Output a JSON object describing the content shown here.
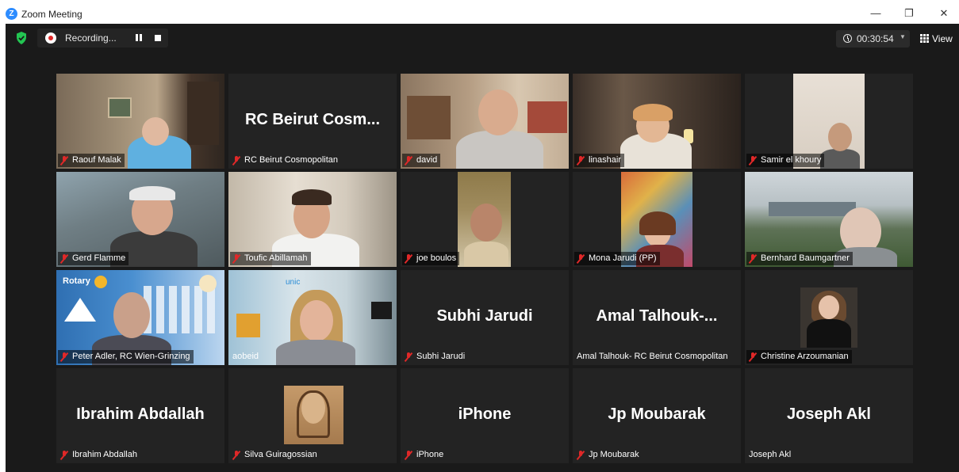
{
  "window": {
    "title": "Zoom Meeting",
    "logo_letter": "Z"
  },
  "toolbar": {
    "recording_label": "Recording...",
    "timer": "00:30:54",
    "view_label": "View"
  },
  "tiles": [
    {
      "label": "Raouf Malak",
      "muted": true
    },
    {
      "label": "RC Beirut Cosmopolitan",
      "muted": true,
      "big_name": "RC Beirut Cosm..."
    },
    {
      "label": "david",
      "muted": true
    },
    {
      "label": "linashair",
      "muted": true
    },
    {
      "label": "Samir el khoury",
      "muted": true
    },
    {
      "label": "Gerd Flamme",
      "muted": true
    },
    {
      "label": "Toufic Abillamah",
      "muted": true
    },
    {
      "label": "joe boulos",
      "muted": true
    },
    {
      "label": "Mona Jarudi (PP)",
      "muted": true
    },
    {
      "label": "Bernhard Baumgartner",
      "muted": true
    },
    {
      "label": "Peter Adler, RC Wien-Grinzing",
      "muted": true,
      "badge": "Rotary"
    },
    {
      "label": "aobeid",
      "muted": false,
      "wall_text": "unic"
    },
    {
      "label": "Subhi Jarudi",
      "muted": true,
      "big_name": "Subhi Jarudi"
    },
    {
      "label": "Amal Talhouk- RC Beirut Cosmopolitan",
      "muted": false,
      "big_name": "Amal  Talhouk-..."
    },
    {
      "label": "Christine Arzoumanian",
      "muted": true
    },
    {
      "label": "Ibrahim Abdallah",
      "muted": true,
      "big_name": "Ibrahim Abdallah"
    },
    {
      "label": "Silva Guiragossian",
      "muted": true
    },
    {
      "label": "iPhone",
      "muted": true,
      "big_name": "iPhone"
    },
    {
      "label": "Jp Moubarak",
      "muted": true,
      "big_name": "Jp Moubarak"
    },
    {
      "label": "Joseph Akl",
      "muted": false,
      "big_name": "Joseph Akl"
    }
  ],
  "colors": {
    "meeting_bg": "#1a1a1a",
    "tile_bg": "#232323",
    "mute_red": "#e02828",
    "active_speaker": "#d9e85a",
    "brand_blue": "#2d8cff"
  },
  "icons": {
    "security": "shield-check-icon",
    "record": "record-icon",
    "pause": "pause-icon",
    "stop": "stop-icon",
    "timer": "clock-icon",
    "view": "grid-icon",
    "muted": "mic-muted-icon"
  }
}
